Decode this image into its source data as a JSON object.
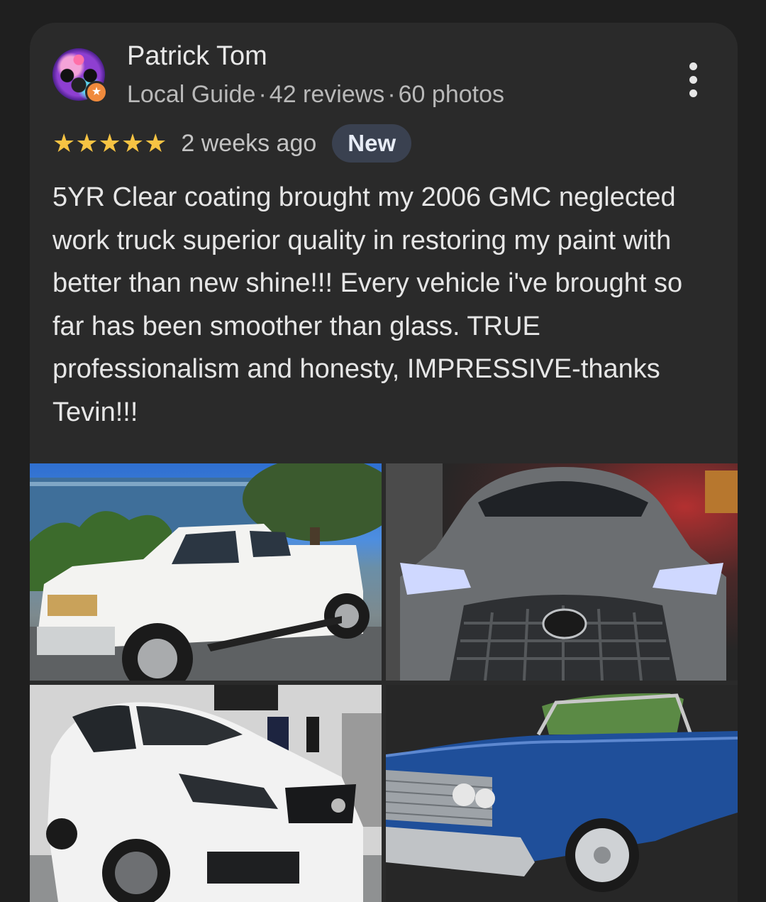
{
  "reviewer": {
    "name": "Patrick Tom",
    "level": "Local Guide",
    "reviews": "42 reviews",
    "photos_count": "60 photos",
    "separator": "·"
  },
  "rating": {
    "stars": "★★★★★",
    "value": 5,
    "max": 5,
    "time": "2 weeks ago",
    "badge": "New"
  },
  "review_text": "5YR Clear coating brought my 2006 GMC neglected work truck superior quality in restoring my paint with better than new shine!!! Every vehicle i've brought so far has been smoother than glass. TRUE professionalism and honesty, IMPRESSIVE-thanks Tevin!!!",
  "icons": {
    "more": "more-vert-icon",
    "guide_badge": "star-badge-icon",
    "star": "star-icon"
  },
  "colors": {
    "background": "#1f1f1f",
    "card": "#2a2a2a",
    "star": "#f6c343",
    "badge_bg": "#3a4150",
    "guide_badge": "#f08a3c"
  }
}
